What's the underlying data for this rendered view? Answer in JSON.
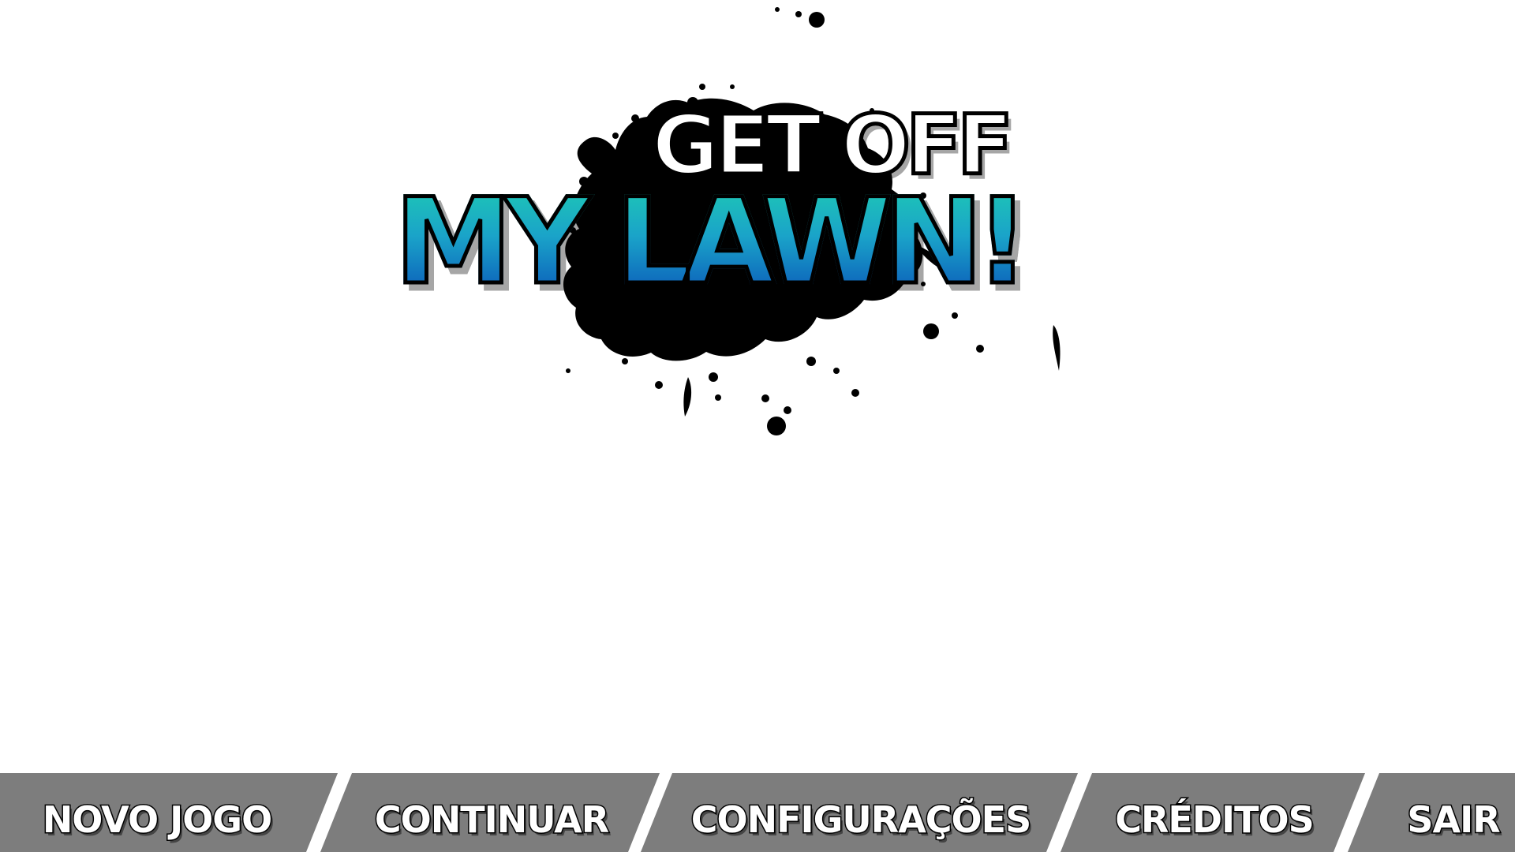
{
  "logo": {
    "line1": "GET OFF",
    "line2": "MY LAWN!",
    "line2_gradient": [
      "#1ec9b4",
      "#0a55b8"
    ],
    "splat_color": "#000000"
  },
  "menu": {
    "background_color": "#7d7d7d",
    "items": [
      {
        "label": "NOVO JOGO"
      },
      {
        "label": "CONTINUAR"
      },
      {
        "label": "CONFIGURAÇÕES"
      },
      {
        "label": "CRÉDITOS"
      },
      {
        "label": "SAIR"
      }
    ]
  }
}
